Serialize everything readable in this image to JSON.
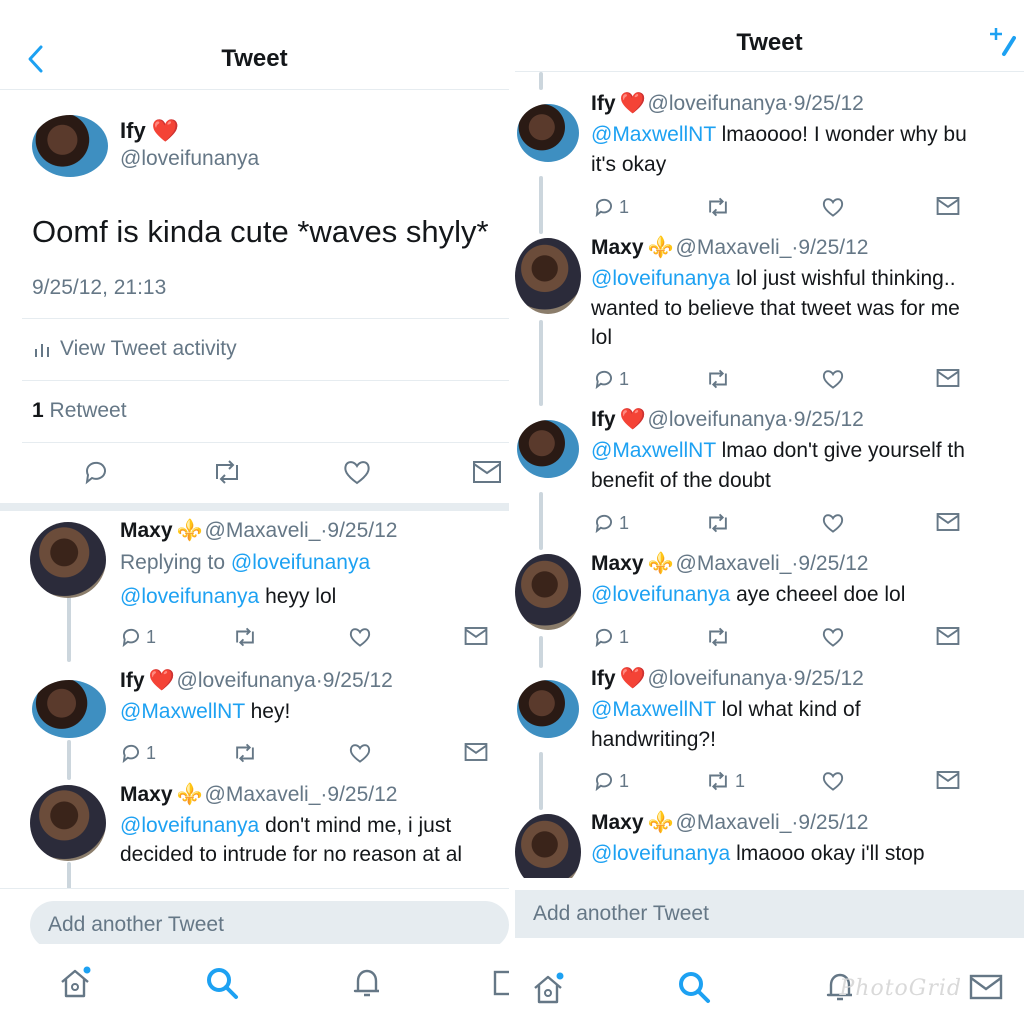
{
  "left": {
    "nav_title": "Tweet",
    "main_tweet": {
      "name": "Ify",
      "emoji": "❤️",
      "handle": "@loveifunanya",
      "text": "Oomf is kinda cute *waves shyly*",
      "timestamp": "9/25/12, 21:13",
      "activity_label": "View Tweet activity",
      "retweet_count": "1",
      "retweet_label": "Retweet"
    },
    "replies": [
      {
        "name": "Maxy",
        "emoji": "⚜️",
        "handle": "@Maxaveli_",
        "date": "9/25/12",
        "replying_prefix": "Replying to",
        "replying_handle": "@loveifunanya",
        "mention": "@loveifunanya",
        "text": "heyy lol",
        "reply_count": "1",
        "retweet_count": ""
      },
      {
        "name": "Ify",
        "emoji": "❤️",
        "handle": "@loveifunanya",
        "date": "9/25/12",
        "mention": "@MaxwellNT",
        "text": "hey!",
        "reply_count": "1",
        "retweet_count": ""
      },
      {
        "name": "Maxy",
        "emoji": "⚜️",
        "handle": "@Maxaveli_",
        "date": "9/25/12",
        "mention": "@loveifunanya",
        "text": "don't mind me, i just",
        "text2": "decided to intrude for no reason at al"
      }
    ],
    "add_placeholder": "Add another Tweet"
  },
  "right": {
    "nav_title": "Tweet",
    "replies": [
      {
        "name": "Ify",
        "emoji": "❤️",
        "handle": "@loveifunanya",
        "date": "9/25/12",
        "mention": "@MaxwellNT",
        "text": "lmaoooo! I wonder why bu",
        "text2": "it's okay",
        "reply_count": "1",
        "retweet_count": ""
      },
      {
        "name": "Maxy",
        "emoji": "⚜️",
        "handle": "@Maxaveli_",
        "date": "9/25/12",
        "mention": "@loveifunanya",
        "text": "lol just wishful thinking..",
        "text2": "wanted to believe that tweet was for me",
        "text3": "lol",
        "reply_count": "1",
        "retweet_count": ""
      },
      {
        "name": "Ify",
        "emoji": "❤️",
        "handle": "@loveifunanya",
        "date": "9/25/12",
        "mention": "@MaxwellNT",
        "text": "lmao don't give yourself th",
        "text2": "benefit of the doubt",
        "reply_count": "1",
        "retweet_count": ""
      },
      {
        "name": "Maxy",
        "emoji": "⚜️",
        "handle": "@Maxaveli_",
        "date": "9/25/12",
        "mention": "@loveifunanya",
        "text": "aye cheeel doe lol",
        "reply_count": "1",
        "retweet_count": ""
      },
      {
        "name": "Ify",
        "emoji": "❤️",
        "handle": "@loveifunanya",
        "date": "9/25/12",
        "mention": "@MaxwellNT",
        "text": "lol what kind of",
        "text2": "handwriting?!",
        "reply_count": "1",
        "retweet_count": "1"
      },
      {
        "name": "Maxy",
        "emoji": "⚜️",
        "handle": "@Maxaveli_",
        "date": "9/25/12",
        "mention": "@loveifunanya",
        "text": "lmaooo okay i'll stop"
      }
    ],
    "add_placeholder": "Add another Tweet",
    "watermark": "PhotoGrid"
  },
  "separator": "·",
  "colors": {
    "accent": "#1da1f2",
    "muted": "#657786",
    "divider": "#e6ecf0",
    "text": "#14171a"
  },
  "icons": [
    "back-icon",
    "compose-icon",
    "reply-icon",
    "retweet-icon",
    "like-icon",
    "dm-icon",
    "home-icon",
    "search-icon",
    "notifications-icon",
    "messages-icon",
    "activity-icon"
  ]
}
